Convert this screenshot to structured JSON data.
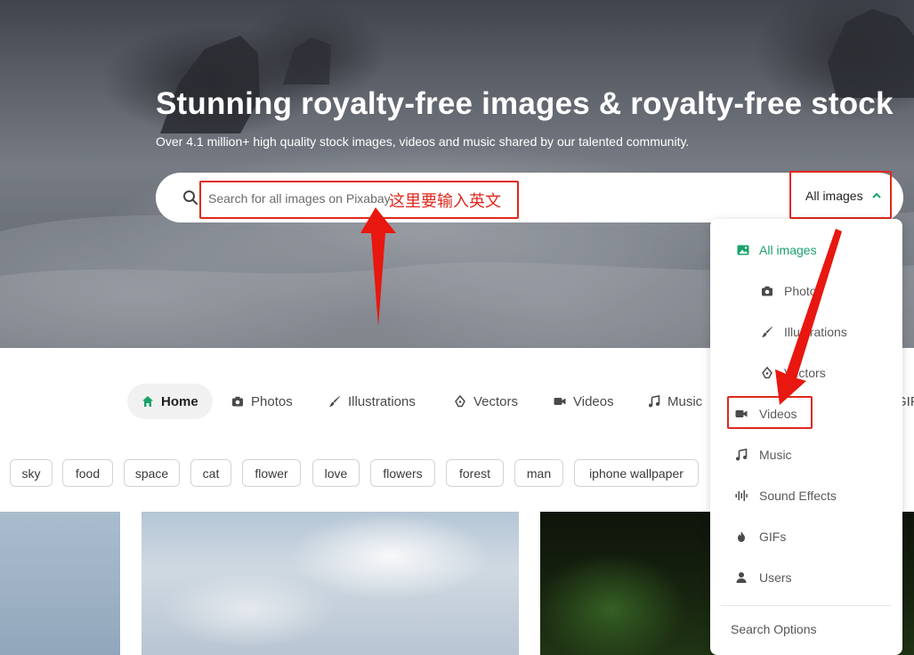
{
  "hero": {
    "title": "Stunning royalty-free images & royalty-free stock",
    "subtitle": "Over 4.1 million+ high quality stock images, videos and music shared by our talented community."
  },
  "search": {
    "placeholder": "Search for all images on Pixabay",
    "annotation": "这里要输入英文",
    "type_selector": "All images"
  },
  "nav": [
    {
      "label": "Home",
      "icon": "home-icon",
      "active": true
    },
    {
      "label": "Photos",
      "icon": "camera-icon"
    },
    {
      "label": "Illustrations",
      "icon": "brush-icon"
    },
    {
      "label": "Vectors",
      "icon": "pen-nib-icon"
    },
    {
      "label": "Videos",
      "icon": "video-camera-icon"
    },
    {
      "label": "Music",
      "icon": "music-note-icon"
    },
    {
      "label": "GIFs",
      "icon": "gif-icon"
    }
  ],
  "tags": [
    "sky",
    "food",
    "space",
    "cat",
    "flower",
    "love",
    "flowers",
    "forest",
    "man",
    "iphone wallpaper"
  ],
  "dropdown": {
    "items": [
      {
        "label": "All images",
        "icon": "image-icon",
        "selected": true
      },
      {
        "label": "Photos",
        "icon": "camera-icon"
      },
      {
        "label": "Illustrations",
        "icon": "brush-icon"
      },
      {
        "label": "Vectors",
        "icon": "pen-nib-icon"
      },
      {
        "label": "Videos",
        "icon": "video-camera-icon"
      },
      {
        "label": "Music",
        "icon": "music-note-icon"
      },
      {
        "label": "Sound Effects",
        "icon": "waveform-icon"
      },
      {
        "label": "GIFs",
        "icon": "flame-icon"
      },
      {
        "label": "Users",
        "icon": "user-icon"
      }
    ],
    "footer": "Search Options"
  },
  "colors": {
    "accent": "#1aa36b",
    "annotation": "#e0281e"
  }
}
